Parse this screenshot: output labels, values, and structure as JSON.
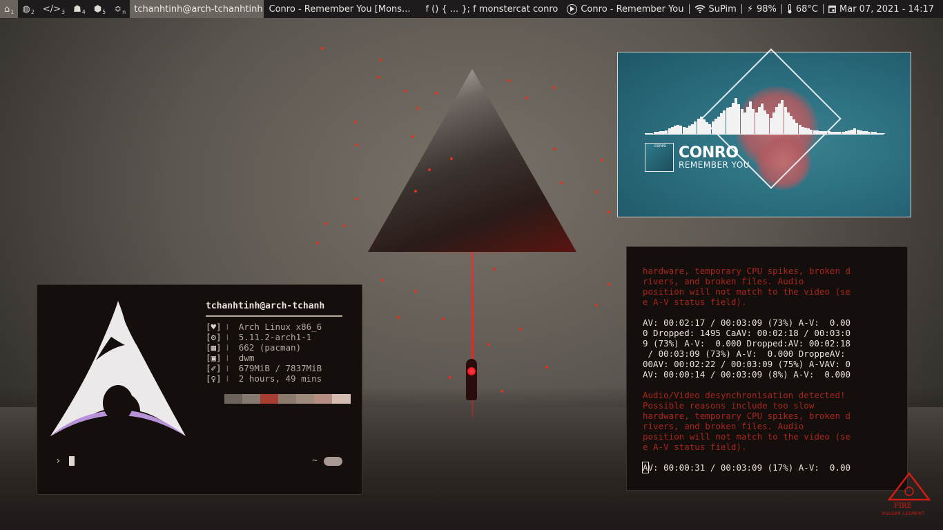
{
  "topbar": {
    "workspaces": [
      {
        "glyph": "⌂",
        "num": "1",
        "active": true
      },
      {
        "glyph": "◍",
        "num": "2",
        "active": false
      },
      {
        "glyph": "</>",
        "num": "3",
        "active": false
      },
      {
        "glyph": "☗",
        "num": "4",
        "active": false
      },
      {
        "glyph": "⬢",
        "num": "5",
        "active": false
      },
      {
        "glyph": "≎",
        "num": "n",
        "active": false
      }
    ],
    "window_titles": [
      "tchanhtinh@arch-tchanhtinh:~",
      "Conro - Remember You [Mons...",
      "f () { ... }; f monstercat conro"
    ],
    "now_playing": "Conro - Remember You",
    "wifi": "SuPim",
    "battery": "98%",
    "temp": "68°C",
    "datetime": "Mar 07, 2021 - 14:17"
  },
  "music": {
    "artist": "CONRO",
    "track": "REMEMBER YOU",
    "cover_label": "conro"
  },
  "neofetch": {
    "user_host": "tchanhtinh@arch-tchanh",
    "lines": [
      {
        "icon": "[♥]",
        "value": "Arch Linux x86_6"
      },
      {
        "icon": "[⚙]",
        "value": "5.11.2-arch1-1"
      },
      {
        "icon": "[▦]",
        "value": "662 (pacman)"
      },
      {
        "icon": "[▣]",
        "value": "dwm"
      },
      {
        "icon": "[✐]",
        "value": "679MiB / 7837MiB"
      },
      {
        "icon": "[♀]",
        "value": "2 hours, 49 mins"
      }
    ],
    "palette": [
      "#6b625a",
      "#847a70",
      "#a83d31",
      "#8c7a6c",
      "#9e8b7b",
      "#b58f82",
      "#d5bbb1"
    ],
    "prompt": "›",
    "tilde": "~"
  },
  "log": {
    "lines": [
      {
        "text": "hardware, temporary CPU spikes, broken d",
        "red": true
      },
      {
        "text": "rivers, and broken files. Audio",
        "red": true
      },
      {
        "text": "position will not match to the video (se",
        "red": true
      },
      {
        "text": "e A-V status field).",
        "red": true
      },
      {
        "text": "",
        "red": false
      },
      {
        "text": "AV: 00:02:17 / 00:03:09 (73%) A-V:  0.00",
        "red": false
      },
      {
        "text": "0 Dropped: 1495 CaAV: 00:02:18 / 00:03:0",
        "red": false
      },
      {
        "text": "9 (73%) A-V:  0.000 Dropped:AV: 00:02:18",
        "red": false
      },
      {
        "text": " / 00:03:09 (73%) A-V:  0.000 DroppeAV:",
        "red": false
      },
      {
        "text": "00AV: 00:02:22 / 00:03:09 (75%) A-VAV: 0",
        "red": false
      },
      {
        "text": "AV: 00:00:14 / 00:03:09 (8%) A-V:  0.000",
        "red": false
      },
      {
        "text": "",
        "red": false
      },
      {
        "text": "Audio/Video desynchronisation detected!",
        "red": true
      },
      {
        "text": "Possible reasons include too slow",
        "red": true
      },
      {
        "text": "hardware, temporary CPU spikes, broken d",
        "red": true
      },
      {
        "text": "rivers, and broken files. Audio",
        "red": true
      },
      {
        "text": "position will not match to the video (se",
        "red": true
      },
      {
        "text": "e A-V status field).",
        "red": true
      },
      {
        "text": "",
        "red": false
      }
    ],
    "last_line_cursor_char": "A",
    "last_line_rest": "V: 00:00:31 / 00:03:09 (17%) A-V:  0.00"
  },
  "watermark": {
    "title": "FIRE",
    "subtitle": "KULDAR LEEMENT"
  }
}
